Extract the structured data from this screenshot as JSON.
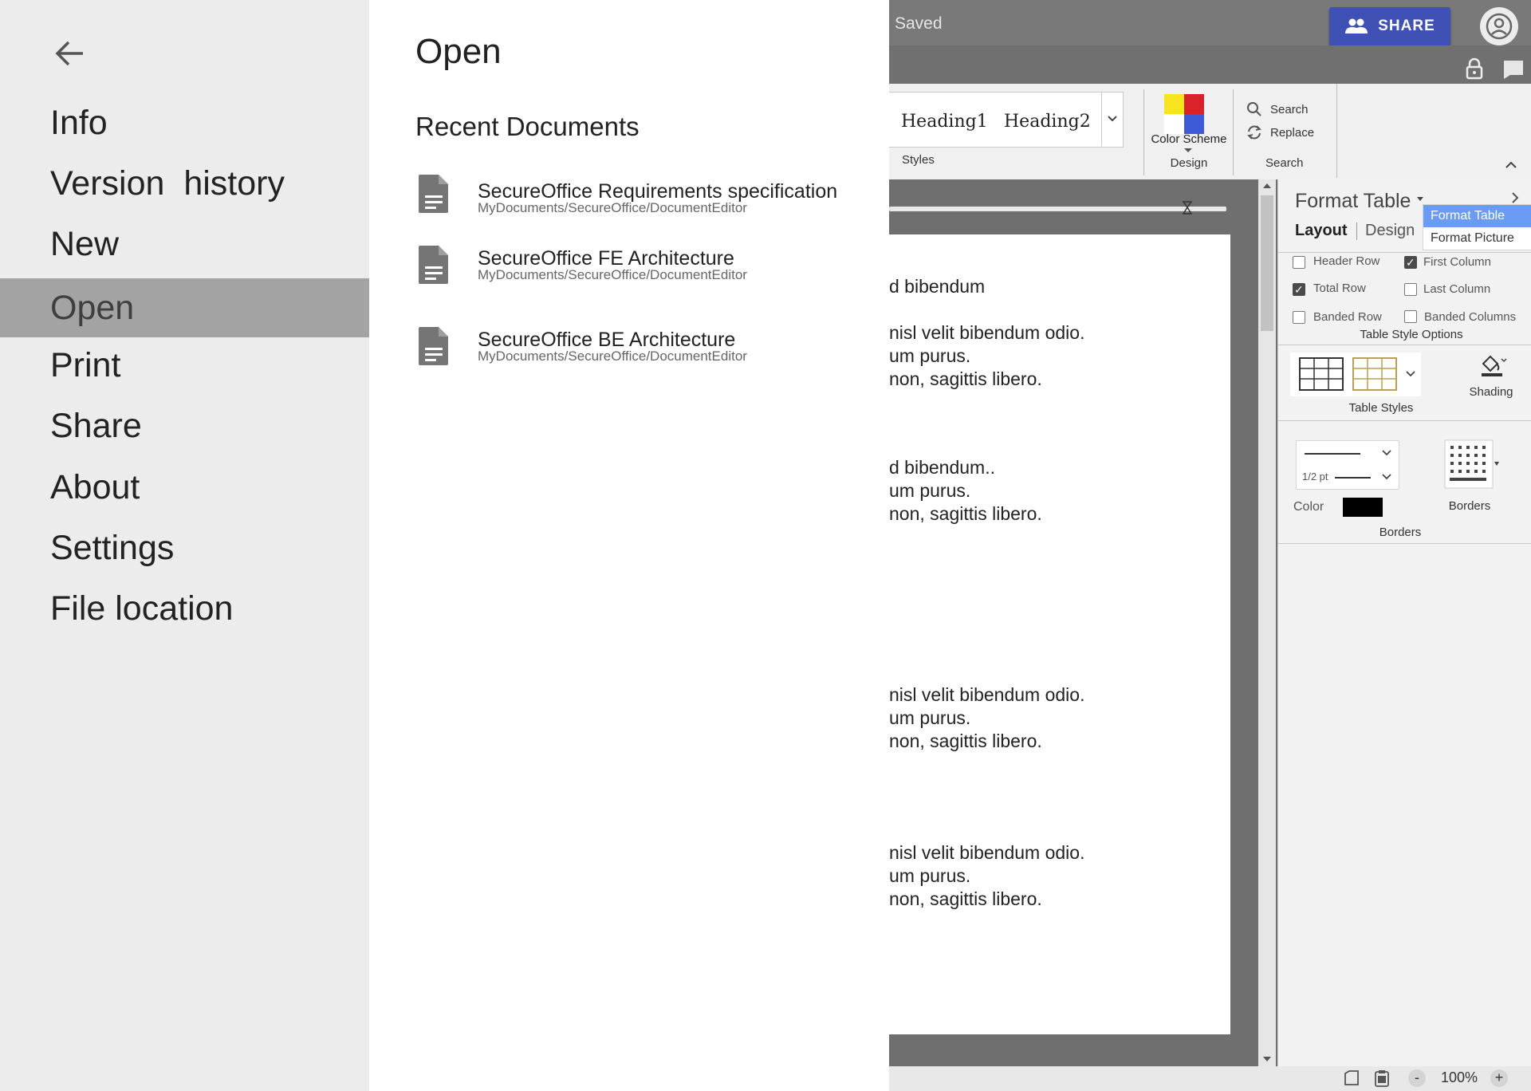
{
  "editor": {
    "status": "Saved",
    "share_label": "SHARE",
    "styles": {
      "items": [
        "Heading1",
        "Heading2"
      ],
      "group_label": "Styles"
    },
    "design": {
      "color_scheme_label": "Color Scheme",
      "group_label": "Design",
      "scheme_colors": [
        "#f6e51f",
        "#d8232a",
        "#ffffff",
        "#3f5ad8"
      ]
    },
    "search_group": {
      "search_label": "Search",
      "replace_label": "Replace",
      "group_label": "Search"
    },
    "document_lines": [
      "d bibendum",
      "nisl velit bibendum odio.",
      "um purus.",
      "non, sagittis libero.",
      "d bibendum..",
      "um purus.",
      "non, sagittis libero.",
      "nisl velit bibendum odio.",
      "um purus.",
      "non, sagittis libero.",
      "nisl velit bibendum odio.",
      "um purus.",
      "non, sagittis libero."
    ],
    "format_panel": {
      "title": "Format Table",
      "dropdown_options": [
        "Format Table",
        "Format Picture"
      ],
      "selected_option": "Format Table",
      "tabs": [
        "Layout",
        "Design"
      ],
      "active_tab": "Layout",
      "checkboxes": [
        {
          "label": "Header Row",
          "checked": false
        },
        {
          "label": "First Column",
          "checked": true
        },
        {
          "label": "Total Row",
          "checked": true
        },
        {
          "label": "Last Column",
          "checked": false
        },
        {
          "label": "Banded Row",
          "checked": false
        },
        {
          "label": "Banded Columns",
          "checked": false
        }
      ],
      "table_style_options_label": "Table Style Options",
      "table_styles_label": "Table Styles",
      "shading_label": "Shading",
      "border_weight": "1/2 pt",
      "color_label": "Color",
      "border_color": "#000000",
      "borders_button_label": "Borders",
      "borders_group_label": "Borders"
    },
    "zoom": "100%",
    "zoom_minus": "-",
    "zoom_plus": "+"
  },
  "file_menu": {
    "items": [
      "Info",
      "Version  history",
      "New",
      "Open",
      "Print",
      "Share",
      "About",
      "Settings",
      "File location"
    ],
    "active": "Open"
  },
  "open_pane": {
    "title": "Open",
    "recent_title": "Recent Documents",
    "documents": [
      {
        "name": "SecureOffice Requirements specification",
        "path": "MyDocuments/SecureOffice/DocumentEditor"
      },
      {
        "name": "SecureOffice FE Architecture",
        "path": "MyDocuments/SecureOffice/DocumentEditor"
      },
      {
        "name": "SecureOffice BE Architecture",
        "path": "MyDocuments/SecureOffice/DocumentEditor"
      }
    ]
  },
  "colors": {
    "accent": "#3f51b5",
    "menu_active": "#a3a3a3",
    "dropdown_highlight": "#6b9cf5"
  }
}
